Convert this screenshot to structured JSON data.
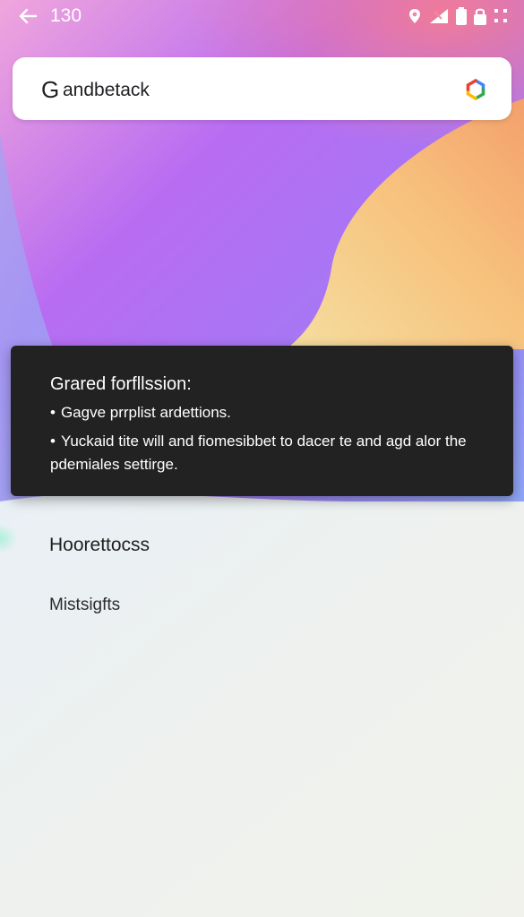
{
  "status_bar": {
    "time": "130",
    "icons": [
      "back-arrow-icon",
      "location-icon",
      "signal-icon",
      "battery-icon",
      "lock-icon",
      "more-icon"
    ]
  },
  "search": {
    "logo": "G",
    "query": "andbetack",
    "lens_icon": "google-lens-icon"
  },
  "permission_panel": {
    "title": "Grared forfllssion:",
    "bullets": [
      "Gagve prrplist ardettions.",
      "Yuckaid tite will and fiomesibbet to dacer te and agd alor the pdemiales settirge."
    ]
  },
  "sections": {
    "heading": "Hoorettocss",
    "item": "Mistsigfts"
  },
  "colors": {
    "panel_bg": "#222222",
    "search_bg": "#ffffff",
    "wallpaper_purple": "#b56cf5",
    "wallpaper_pink": "#f278b2",
    "wallpaper_orange": "#f7b26b",
    "wallpaper_blue": "#8fb2f5"
  }
}
